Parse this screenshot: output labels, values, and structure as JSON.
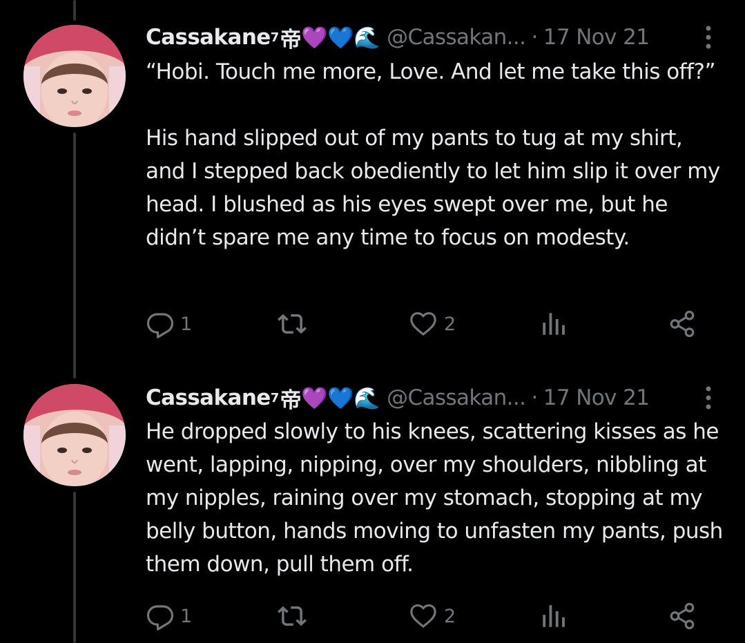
{
  "tweets": [
    {
      "author": {
        "name": "Cassakane",
        "superscript": "7",
        "suffix": "帝",
        "emoji_1": "💜",
        "emoji_2": "💙",
        "emoji_3": "🌊",
        "handle": "@Cassakan...",
        "avatar": "user-avatar"
      },
      "separator": "·",
      "date": "17 Nov 21",
      "text": "“Hobi. Touch me more, Love. And let me take this off?”\n\nHis hand slipped out of my pants to tug at my shirt, and I stepped back obediently to let him slip it over my head. I blushed as his eyes swept over me, but he didn’t spare me any time to focus on modesty.",
      "replies": "1",
      "retweets": "",
      "likes": "2",
      "views": ""
    },
    {
      "author": {
        "name": "Cassakane",
        "superscript": "7",
        "suffix": "帝",
        "emoji_1": "💜",
        "emoji_2": "💙",
        "emoji_3": "🌊",
        "handle": "@Cassakan...",
        "avatar": "user-avatar"
      },
      "separator": "·",
      "date": "17 Nov 21",
      "text": "He dropped slowly to his knees, scattering kisses as he went, lapping, nipping, over my shoulders, nibbling at my nipples, raining over my stomach, stopping at my belly button, hands moving to unfasten my pants, push them down, pull them off.",
      "replies": "1",
      "retweets": "",
      "likes": "2",
      "views": ""
    }
  ],
  "icons": {
    "reply": "reply-icon",
    "retweet": "retweet-icon",
    "like": "heart-icon",
    "views": "views-icon",
    "share": "share-icon",
    "more": "more-icon"
  },
  "colors": {
    "background": "#000000",
    "text": "#e7e9ea",
    "secondary": "#71767b",
    "thread_line": "#333639"
  }
}
